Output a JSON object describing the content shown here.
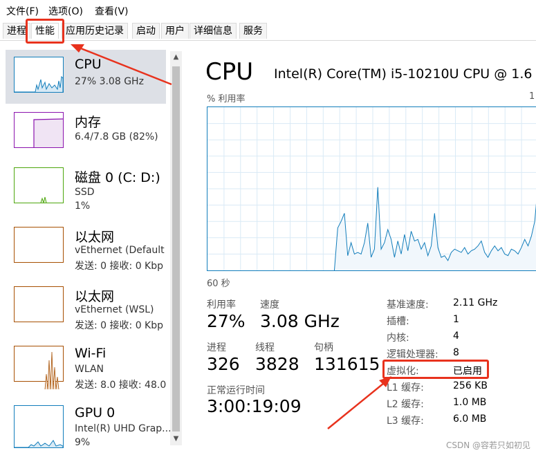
{
  "menu": [
    "文件(F)",
    "选项(O)",
    "查看(V)"
  ],
  "tabs": [
    "进程",
    "性能",
    "应用历史记录",
    "启动",
    "用户",
    "详细信息",
    "服务"
  ],
  "active_tab": "性能",
  "sidebar": {
    "items": [
      {
        "title": "CPU",
        "lines": [
          "27%  3.08 GHz"
        ],
        "color": "#117dbb",
        "icon": "cpu-graph"
      },
      {
        "title": "内存",
        "lines": [
          "6.4/7.8 GB (82%)"
        ],
        "color": "#8b12ae",
        "icon": "memory-graph"
      },
      {
        "title": "磁盘 0 (C: D:)",
        "lines": [
          "SSD",
          "1%"
        ],
        "color": "#4da60c",
        "icon": "disk-graph"
      },
      {
        "title": "以太网",
        "lines": [
          "vEthernet (Default",
          "发送: 0 接收: 0 Kbp"
        ],
        "color": "#a74f01",
        "icon": "ethernet-graph"
      },
      {
        "title": "以太网",
        "lines": [
          "vEthernet (WSL)",
          "发送: 0 接收: 0 Kbp"
        ],
        "color": "#a74f01",
        "icon": "ethernet-graph"
      },
      {
        "title": "Wi-Fi",
        "lines": [
          "WLAN",
          "发送: 8.0 接收: 48.0"
        ],
        "color": "#a74f01",
        "icon": "wifi-graph"
      },
      {
        "title": "GPU 0",
        "lines": [
          "Intel(R) UHD Grap...",
          "9%"
        ],
        "color": "#117dbb",
        "icon": "gpu-graph"
      }
    ]
  },
  "main": {
    "title": "CPU",
    "model": "Intel(R) Core(TM) i5-10210U CPU @ 1.6",
    "graph_label": "% 利用率",
    "graph_max": "1",
    "graph_time": "60 秒",
    "stats": {
      "utilization_label": "利用率",
      "utilization": "27%",
      "speed_label": "速度",
      "speed": "3.08 GHz",
      "processes_label": "进程",
      "processes": "326",
      "threads_label": "线程",
      "threads": "3828",
      "handles_label": "句柄",
      "handles": "131615",
      "uptime_label": "正常运行时间",
      "uptime": "3:00:19:09"
    },
    "details": [
      {
        "key": "基准速度:",
        "value": "2.11 GHz"
      },
      {
        "key": "插槽:",
        "value": "1"
      },
      {
        "key": "内核:",
        "value": "4"
      },
      {
        "key": "逻辑处理器:",
        "value": "8"
      },
      {
        "key": "虚拟化:",
        "value": "已启用"
      },
      {
        "key": "L1 缓存:",
        "value": "256 KB"
      },
      {
        "key": "L2 缓存:",
        "value": "1.0 MB"
      },
      {
        "key": "L3 缓存:",
        "value": "6.0 MB"
      }
    ]
  },
  "chart_data": {
    "type": "area",
    "ylim": [
      0,
      100
    ],
    "series": [
      {
        "values": [
          0,
          0,
          0,
          0,
          0,
          0,
          0,
          0,
          0,
          0,
          0,
          0,
          0,
          0,
          0,
          0,
          0,
          0,
          0,
          0,
          0,
          0,
          0,
          0,
          0,
          0,
          0,
          0,
          0,
          0,
          0,
          0,
          0,
          0,
          0,
          0,
          0,
          0,
          0,
          26,
          30,
          35,
          9,
          17,
          10,
          11,
          10,
          17,
          29,
          8,
          13,
          51,
          13,
          17,
          25,
          19,
          8,
          18,
          10,
          22,
          12,
          24,
          18,
          19,
          13,
          17,
          9,
          15,
          35,
          14,
          8,
          9,
          6,
          11,
          13,
          12,
          11,
          14,
          10,
          12,
          13,
          15,
          18,
          11,
          8,
          12,
          15,
          12,
          14,
          10,
          9,
          13,
          12,
          10,
          14,
          19,
          15,
          21,
          30,
          53
        ]
      }
    ]
  },
  "watermark": "CSDN @容若只如初见"
}
